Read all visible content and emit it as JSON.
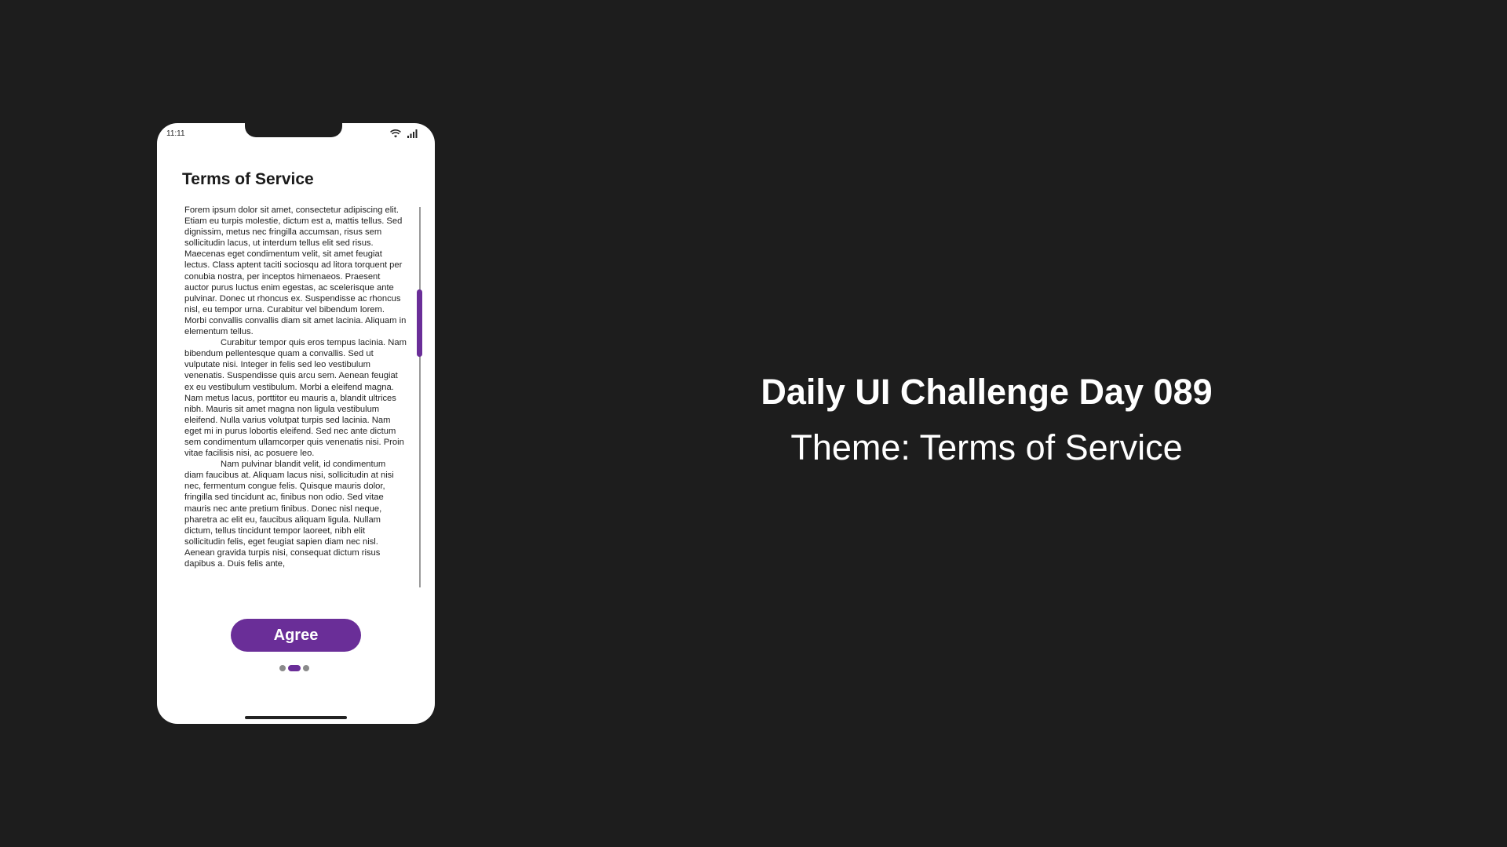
{
  "status": {
    "time": "11:11"
  },
  "screen": {
    "title": "Terms of Service",
    "paragraphs": [
      "Forem ipsum dolor sit amet, consectetur adipiscing elit. Etiam eu turpis molestie, dictum est a, mattis tellus. Sed dignissim, metus nec fringilla accumsan, risus sem sollicitudin lacus, ut interdum tellus elit sed risus. Maecenas eget condimentum velit, sit amet feugiat lectus. Class aptent taciti sociosqu ad litora torquent per conubia nostra, per inceptos himenaeos. Praesent auctor purus luctus enim egestas, ac scelerisque ante pulvinar. Donec ut rhoncus ex. Suspendisse ac rhoncus nisl, eu tempor urna. Curabitur vel bibendum lorem. Morbi convallis convallis diam sit amet lacinia. Aliquam in elementum tellus.",
      "Curabitur tempor quis eros tempus lacinia. Nam bibendum pellentesque quam a convallis. Sed ut vulputate nisi. Integer in felis sed leo vestibulum venenatis. Suspendisse quis arcu sem. Aenean feugiat ex eu vestibulum vestibulum. Morbi a eleifend magna. Nam metus lacus, porttitor eu mauris a, blandit ultrices nibh. Mauris sit amet magna non ligula vestibulum eleifend. Nulla varius volutpat turpis sed lacinia. Nam eget mi in purus lobortis eleifend. Sed nec ante dictum sem condimentum ullamcorper quis venenatis nisi. Proin vitae facilisis nisi, ac posuere leo.",
      "Nam pulvinar blandit velit, id condimentum diam faucibus at. Aliquam lacus nisi, sollicitudin at nisi nec, fermentum congue felis. Quisque mauris dolor, fringilla sed tincidunt ac, finibus non odio. Sed vitae mauris nec ante pretium finibus. Donec nisl neque, pharetra ac elit eu, faucibus aliquam ligula. Nullam dictum, tellus tincidunt tempor laoreet, nibh elit sollicitudin felis, eget feugiat sapien diam nec nisl. Aenean gravida turpis nisi, consequat dictum risus dapibus a. Duis felis ante,"
    ],
    "agree_label": "Agree",
    "pager": {
      "count": 3,
      "active_index": 1
    }
  },
  "headline": {
    "title": "Daily UI Challenge Day 089",
    "subtitle": "Theme: Terms of Service"
  },
  "colors": {
    "accent": "#6a2e98",
    "background": "#1d1d1d"
  },
  "icons": [
    "wifi-icon",
    "signal-icon"
  ]
}
